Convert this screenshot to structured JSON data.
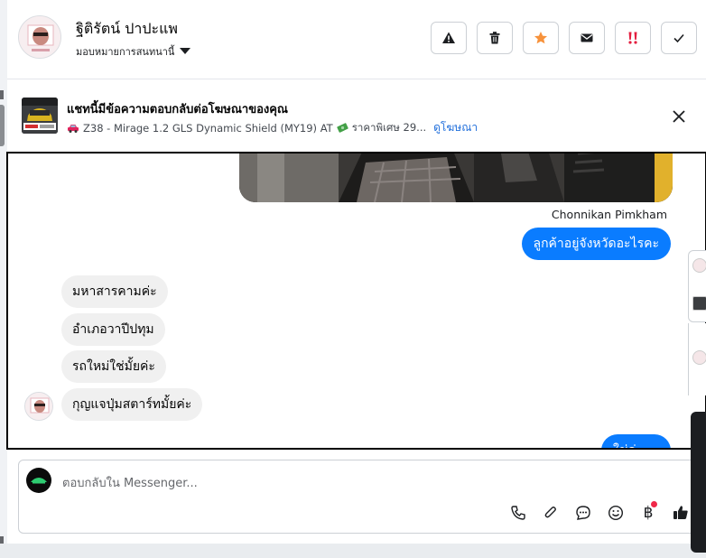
{
  "header": {
    "contact_name": "ฐิติรัตน์ ปาปะแพ",
    "assign_label": "มอบหมายการสนทนานี้",
    "actions": [
      {
        "name": "spam-button",
        "icon": "warning-icon"
      },
      {
        "name": "delete-button",
        "icon": "trash-icon"
      },
      {
        "name": "follow-up-button",
        "icon": "star-icon",
        "color": "#f7923b"
      },
      {
        "name": "mark-unread-button",
        "icon": "envelope-icon"
      },
      {
        "name": "priority-button",
        "icon": "double-exclamation-icon",
        "color": "#e41e3f"
      },
      {
        "name": "mark-done-button",
        "icon": "checkmark-icon"
      }
    ]
  },
  "ad_banner": {
    "title": "แชทนี้มีข้อความตอบกลับต่อโฆษณาของคุณ",
    "subtitle": "Z38 - Mirage 1.2 GLS Dynamic Shield (MY19) AT",
    "price": "ราคาพิเศษ 29...",
    "link": "ดูโฆษณา"
  },
  "conversation": {
    "sender_name": "Chonnikan Pimkham",
    "messages": [
      {
        "direction": "out",
        "text": "ลูกค้าอยู่จังหวัดอะไรคะ"
      },
      {
        "direction": "in",
        "text": "มหาสารคามค่ะ"
      },
      {
        "direction": "in",
        "text": "อำเภอวาปีปทุม"
      },
      {
        "direction": "in",
        "text": "รถใหม่ใช่มั้ยค่ะ"
      },
      {
        "direction": "in",
        "text": "กุญแจปุ่มสตาร์ทมั้ยค่ะ"
      },
      {
        "direction": "out",
        "text": "ใช่ค่ะ ..."
      }
    ]
  },
  "composer": {
    "placeholder": "ตอบกลับใน Messenger...",
    "tools": [
      "phone-icon",
      "paperclip-icon",
      "saved-reply-icon",
      "emoji-icon",
      "baht-icon",
      "thumbs-up-icon"
    ],
    "baht_symbol": "฿"
  },
  "colors": {
    "accent": "#0a7cff",
    "link": "#216fdb",
    "notification": "#f02849"
  }
}
